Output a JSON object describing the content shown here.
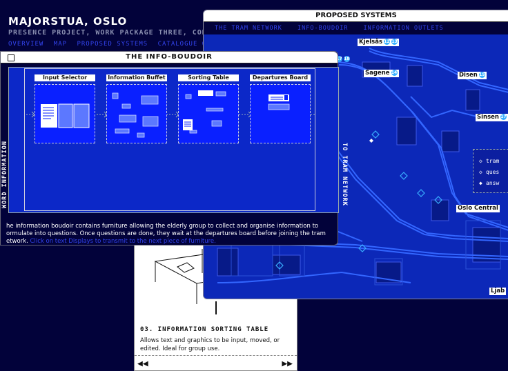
{
  "background": {
    "title": "MAJORSTUA, OSLO",
    "subtitle": "PRESENCE PROJECT, WORK PACKAGE THREE, COMPUTER RELAT",
    "nav": [
      "OVERVIEW",
      "MAP",
      "PROPOSED SYSTEMS",
      "CATALOGUE OF PARTS"
    ]
  },
  "info_card": {
    "title": "03. INFORMATION SORTING TABLE",
    "description": "Allows text and graphics to be input, moved, or edited. Ideal for group use.",
    "prev_label": "◀◀",
    "next_label": "▶▶"
  },
  "proposed_systems": {
    "title": "PROPOSED SYSTEMS",
    "tabs": [
      "THE TRAM NETWORK",
      "INFO-BOUDOIR",
      "INFORMATION OUTLETS"
    ],
    "places": [
      {
        "name": "Kjelsås",
        "badges": [
          "12",
          "13"
        ]
      },
      {
        "name": "Sagene",
        "badges": [
          "14"
        ]
      },
      {
        "name": "Disen",
        "badges": [
          "15"
        ]
      },
      {
        "name": "Sinsen",
        "badges": [
          "17"
        ]
      },
      {
        "name": "Oslo Central",
        "badges": []
      },
      {
        "name": "Ljab",
        "badges": []
      }
    ],
    "legend": [
      {
        "symbol": "◇",
        "label": "tram"
      },
      {
        "symbol": "◇",
        "label": "ques"
      },
      {
        "symbol": "◆",
        "label": "answ"
      }
    ],
    "left_badges": [
      "17",
      "18"
    ],
    "accent": "#0c28b8"
  },
  "info_boudoir": {
    "title": "THE INFO-BOUDOIR",
    "left_label": "WORD INFORMATION",
    "right_label": "TO TRAM NETWORK",
    "stations": [
      {
        "label": "Input Selector"
      },
      {
        "label": "Information Buffet"
      },
      {
        "label": "Sorting Table"
      },
      {
        "label": "Departures Board"
      }
    ],
    "caption": "he information boudoir contains furniture allowing the elderly group to collect and organise information to ormulate into questions. Once questions are done, they wait at the departures board before joining the tram etwork.",
    "caption_hint": "Click on text Displays to transmit to the next piece of furniture."
  }
}
